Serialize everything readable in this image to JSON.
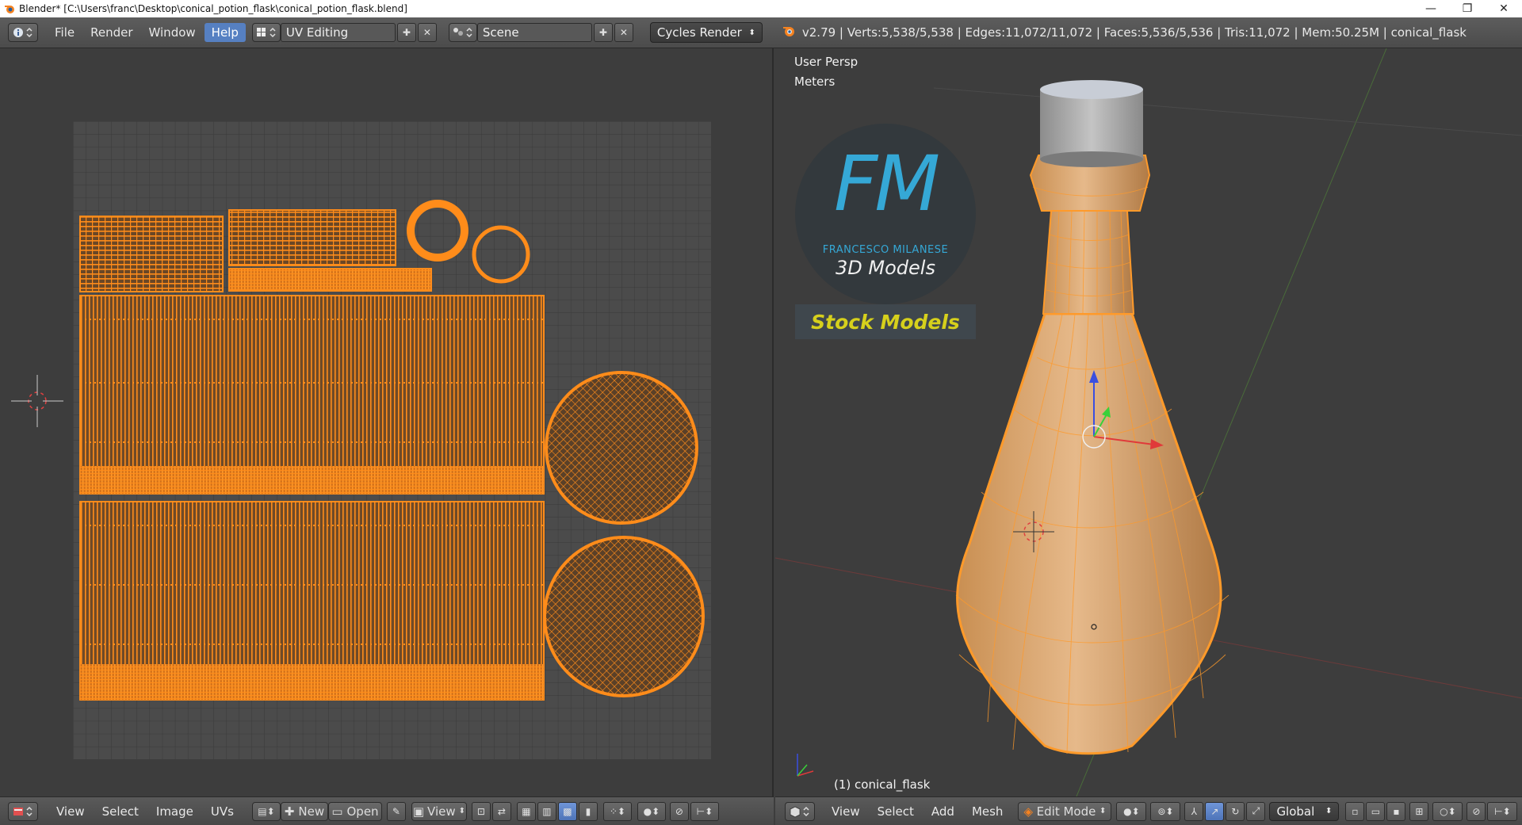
{
  "window": {
    "title": "Blender* [C:\\Users\\franc\\Desktop\\conical_potion_flask\\conical_potion_flask.blend]",
    "controls": {
      "minimize": "—",
      "maximize": "❐",
      "close": "✕"
    }
  },
  "info_header": {
    "menus": [
      "File",
      "Render",
      "Window",
      "Help"
    ],
    "active_menu": "Help",
    "screen_layout": "UV Editing",
    "scene": "Scene",
    "render_engine": "Cycles Render",
    "stats": "v2.79 | Verts:5,538/5,538 | Edges:11,072/11,072 | Faces:5,536/5,536 | Tris:11,072 | Mem:50.25M | conical_flask"
  },
  "viewport": {
    "view_label": "User Persp",
    "units_label": "Meters",
    "object_label": "(1) conical_flask",
    "watermark": {
      "logo_letters": "FM",
      "author": "FRANCESCO MILANESE",
      "subtitle": "3D Models",
      "banner": "Stock Models"
    }
  },
  "uv_header": {
    "menus": [
      "View",
      "Select",
      "Image",
      "UVs"
    ],
    "new_label": "New",
    "open_label": "Open",
    "view_label": "View"
  },
  "view3d_header": {
    "menus": [
      "View",
      "Select",
      "Add",
      "Mesh"
    ],
    "mode": "Edit Mode",
    "orientation": "Global"
  },
  "colors": {
    "uv_orange": "#ff8c1a",
    "selection_blue": "#5680c2",
    "background": "#3d3d3d",
    "grid_bg": "#4b4b4b"
  }
}
